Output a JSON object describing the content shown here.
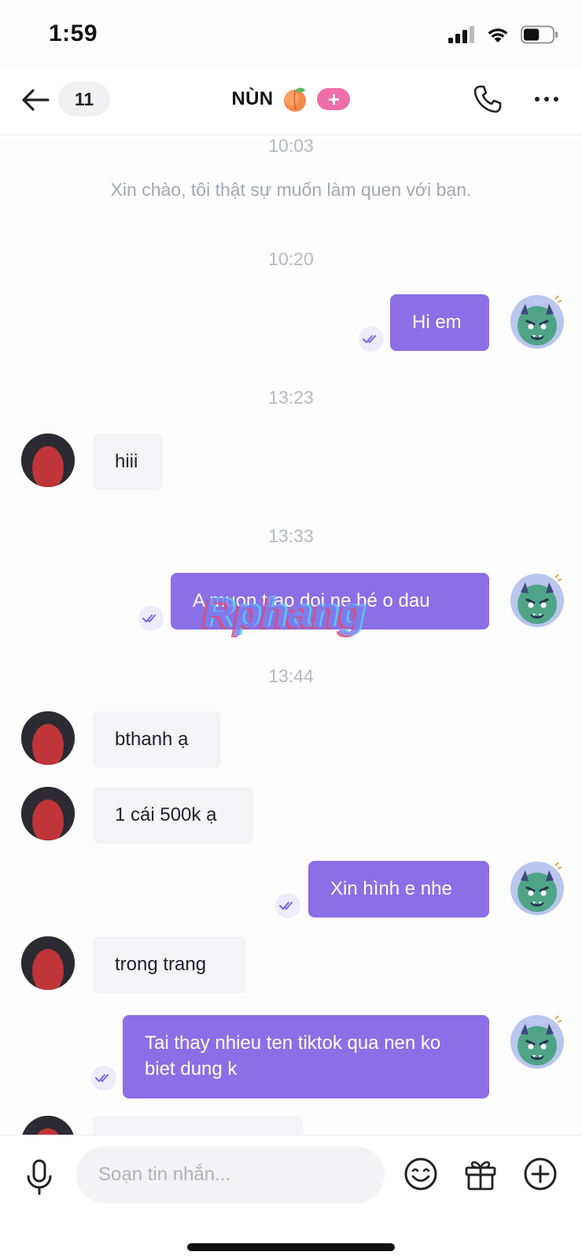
{
  "status_bar": {
    "time": "1:59",
    "battery_level": 0.55
  },
  "header": {
    "back_icon": "arrow-left-icon",
    "unread_count": "11",
    "title": "NÙN",
    "title_emoji_icon": "peach-emoji-icon",
    "add_badge": "+",
    "call_icon": "phone-icon",
    "more_icon": "more-dots-icon"
  },
  "colors": {
    "outgoing_bubble": "#8b6fe6",
    "incoming_bubble": "#f4f4f7",
    "add_badge": "#ee6fa8",
    "timestamp": "#b7b8c2"
  },
  "messages": [
    {
      "type": "timestamp",
      "text": "10:03"
    },
    {
      "type": "system",
      "text": "Xin chào, tôi thật sự muốn làm quen với bạn."
    },
    {
      "type": "timestamp",
      "text": "10:20"
    },
    {
      "type": "outgoing",
      "text": "Hi em",
      "read": true
    },
    {
      "type": "timestamp",
      "text": "13:23"
    },
    {
      "type": "incoming",
      "text": "hiii"
    },
    {
      "type": "timestamp",
      "text": "13:33"
    },
    {
      "type": "outgoing",
      "text": "A muon trao doi ne bé o dau",
      "read": true
    },
    {
      "type": "timestamp",
      "text": "13:44"
    },
    {
      "type": "incoming",
      "text": "bthanh ạ"
    },
    {
      "type": "incoming",
      "text": "1 cái 500k ạ"
    },
    {
      "type": "outgoing",
      "text": "Xin hình e nhe",
      "read": true
    },
    {
      "type": "incoming",
      "text": "trong trang"
    },
    {
      "type": "outgoing",
      "text": "Tai thay nhieu ten tiktok qua nen ko biet dung k",
      "read": true
    }
  ],
  "watermark": "Rphang",
  "input_bar": {
    "mic_icon": "microphone-icon",
    "placeholder": "Soạn tin nhắn...",
    "emoji_icon": "emoji-smile-icon",
    "gift_icon": "gift-icon",
    "add_icon": "plus-circle-icon"
  }
}
